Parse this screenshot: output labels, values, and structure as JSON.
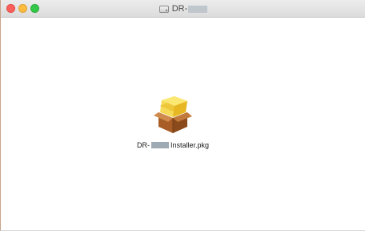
{
  "window": {
    "title_prefix": "DR-"
  },
  "file": {
    "name_prefix": "DR-",
    "name_suffix": "Installer.pkg",
    "icon": "package-icon"
  },
  "colors": {
    "close": "#fc605b",
    "minimize": "#fdbc40",
    "zoom": "#34c84a"
  }
}
